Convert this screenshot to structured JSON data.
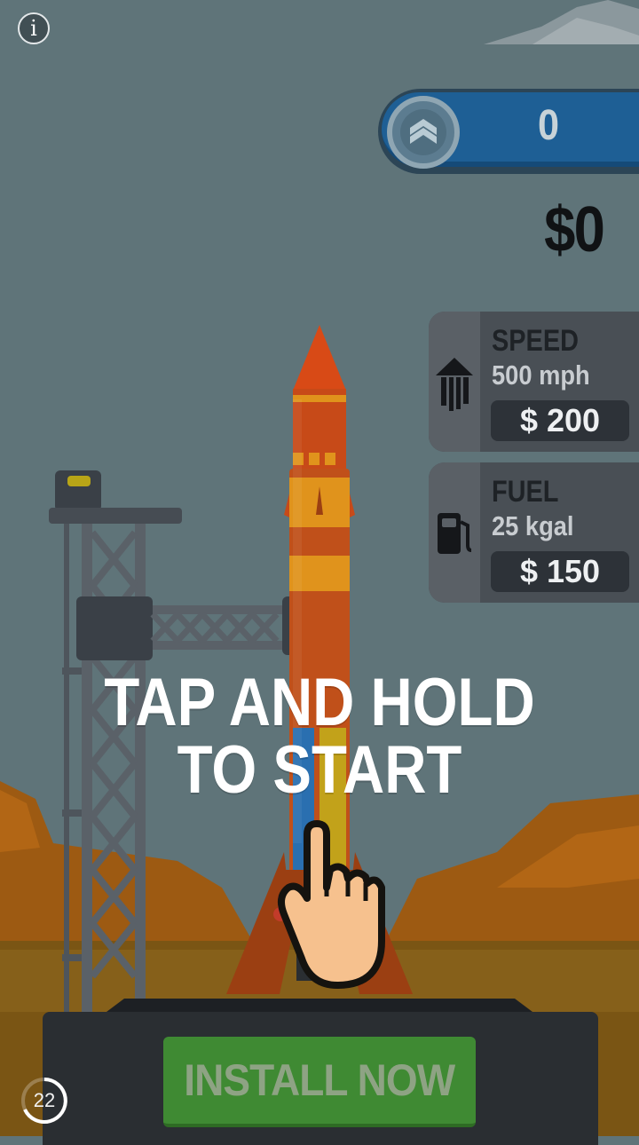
{
  "hud": {
    "info_symbol": "i",
    "level_value": "0",
    "money": "$0"
  },
  "upgrades": [
    {
      "title": "SPEED",
      "stat": "500 mph",
      "price": "$ 200",
      "icon": "speed-arrow-icon"
    },
    {
      "title": "FUEL",
      "stat": "25 kgal",
      "price": "$ 150",
      "icon": "fuel-pump-icon"
    }
  ],
  "instruction": {
    "line1": "TAP AND HOLD",
    "line2": "TO START"
  },
  "ad": {
    "install_label": "INSTALL NOW",
    "countdown": "22"
  },
  "colors": {
    "sky": "#5f7479",
    "rocket_body": "#c0501a",
    "rocket_stripe": "#e0931c",
    "install_green": "#3f8a33",
    "level_blue": "#1e5f95"
  }
}
